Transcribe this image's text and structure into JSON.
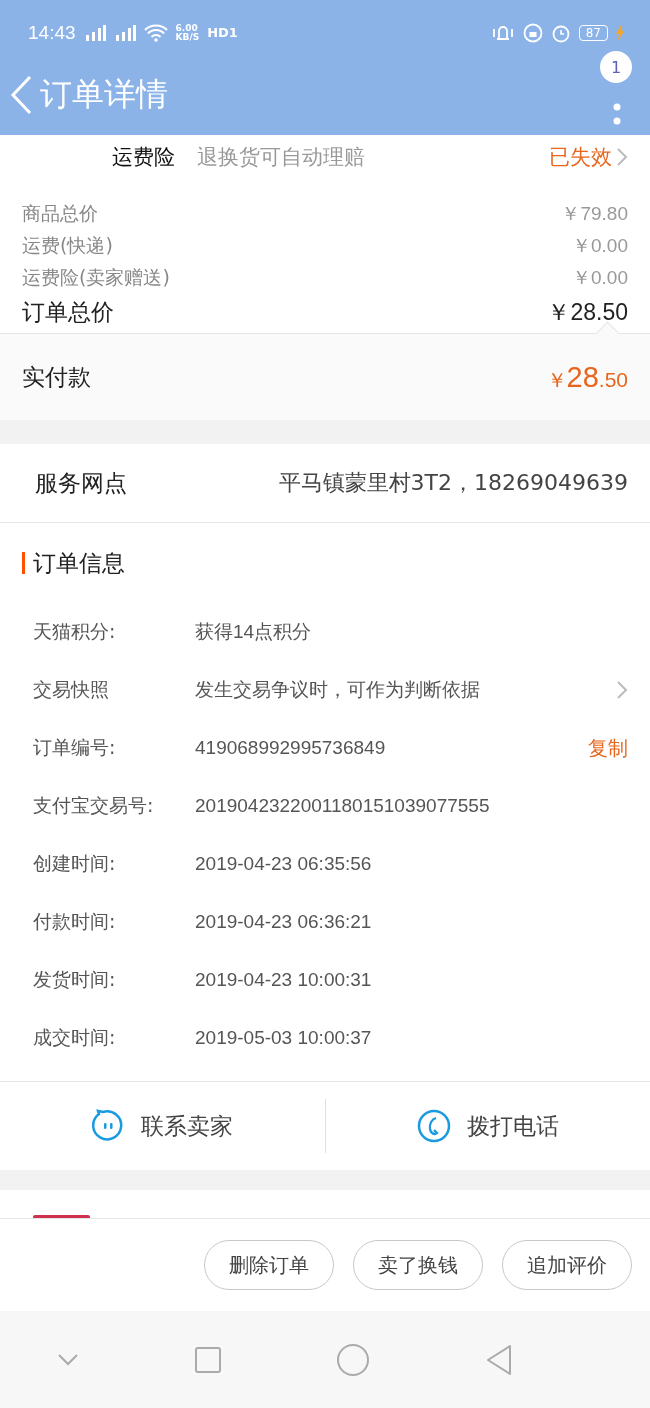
{
  "status_bar": {
    "time": "14:43",
    "net_speed": "6.00",
    "net_unit": "KB/S",
    "hd": "HD1",
    "battery": "87",
    "charging": true
  },
  "header": {
    "title": "订单详情",
    "badge": "1"
  },
  "insurance": {
    "name": "运费险",
    "desc": "退换货可自动理赔",
    "status": "已失效"
  },
  "prices": [
    {
      "label": "商品总价",
      "value": "￥79.80",
      "kind": "minor"
    },
    {
      "label": "运费(快递)",
      "value": "￥0.00",
      "kind": "minor"
    },
    {
      "label": "运费险(卖家赠送)",
      "value": "￥0.00",
      "kind": "minor"
    },
    {
      "label": "订单总价",
      "value": "￥28.50",
      "kind": "total"
    }
  ],
  "paid": {
    "label": "实付款",
    "currency": "￥",
    "integer": "28",
    "decimal": ".50"
  },
  "service_point": {
    "label": "服务网点",
    "value": "平马镇蒙里村3T2，18269049639"
  },
  "order_info": {
    "title": "订单信息",
    "rows": [
      {
        "label": "天猫积分:",
        "value": "获得14点积分",
        "chevron": false
      },
      {
        "label": "交易快照",
        "value": "发生交易争议时，可作为判断依据",
        "chevron": true
      },
      {
        "label": "订单编号:",
        "value": "419068992995736849",
        "chevron": false,
        "copy": "复制"
      },
      {
        "label": "支付宝交易号:",
        "value": "2019042322001180151039077555",
        "chevron": false
      },
      {
        "label": "创建时间:",
        "value": "2019-04-23 06:35:56",
        "chevron": false
      },
      {
        "label": "付款时间:",
        "value": "2019-04-23 06:36:21",
        "chevron": false
      },
      {
        "label": "发货时间:",
        "value": "2019-04-23 10:00:31",
        "chevron": false
      },
      {
        "label": "成交时间:",
        "value": "2019-05-03 10:00:37",
        "chevron": false
      }
    ]
  },
  "contact": [
    {
      "label": "联系卖家",
      "kind": "chat"
    },
    {
      "label": "拨打电话",
      "kind": "phone"
    }
  ],
  "actions": [
    "删除订单",
    "卖了换钱",
    "追加评价"
  ]
}
